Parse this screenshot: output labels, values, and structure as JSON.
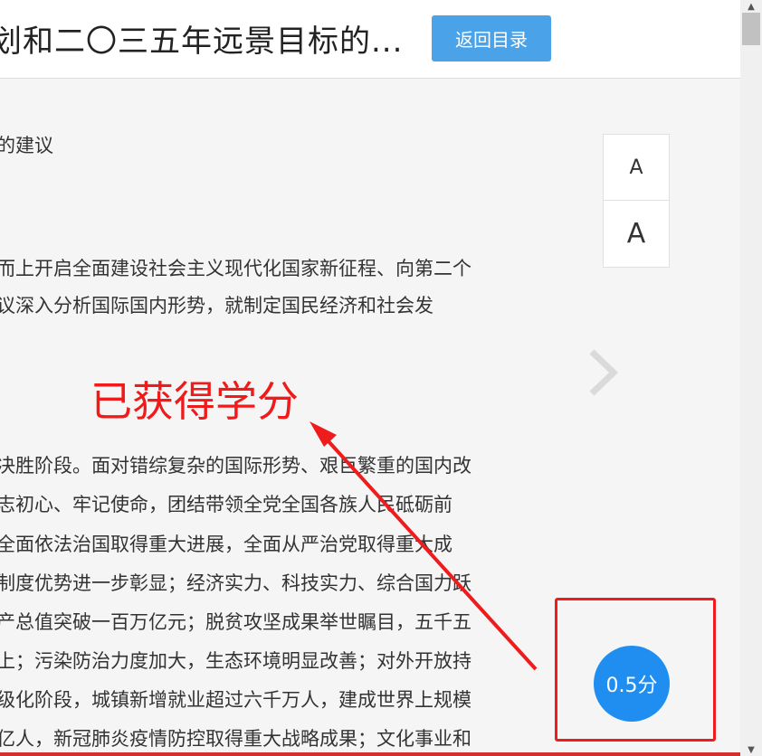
{
  "header": {
    "title": "划和二〇三五年远景目标的...",
    "back_label": "返回目录"
  },
  "content": {
    "lines": [
      "的建议",
      "而上开启全面建设社会主义现代化国家新征程、向第二个",
      "议深入分析国际国内形势，就制定国民经济和社会发",
      "决胜阶段。面对错综复杂的国际形势、艰巨繁重的国内改",
      "志初心、牢记使命，团结带领全党全国各族人民砥砺前",
      "全面依法治国取得重大进展，全面从严治党取得重大成",
      "制度优势进一步彰显；经济实力、科技实力、综合国力跃",
      "产总值突破一百万亿元；脱贫攻坚成果举世瞩目，五千五",
      "上；污染防治力度加大，生态环境明显改善；对外开放持",
      "级化阶段，城镇新增就业超过六千万人，建成世界上规模",
      "亿人，新冠肺炎疫情防控取得重大战略成果；文化事业和"
    ]
  },
  "font_controls": {
    "small_label": "A",
    "large_label": "A"
  },
  "annotation": {
    "text": "已获得学分",
    "color": "#f01a1a"
  },
  "score": {
    "label": "0.5分",
    "color": "#1f8ef0"
  },
  "scrollbar": {
    "up_glyph": "▲",
    "down_glyph": "▼"
  },
  "icons": {
    "next": "chevron-right-icon"
  }
}
